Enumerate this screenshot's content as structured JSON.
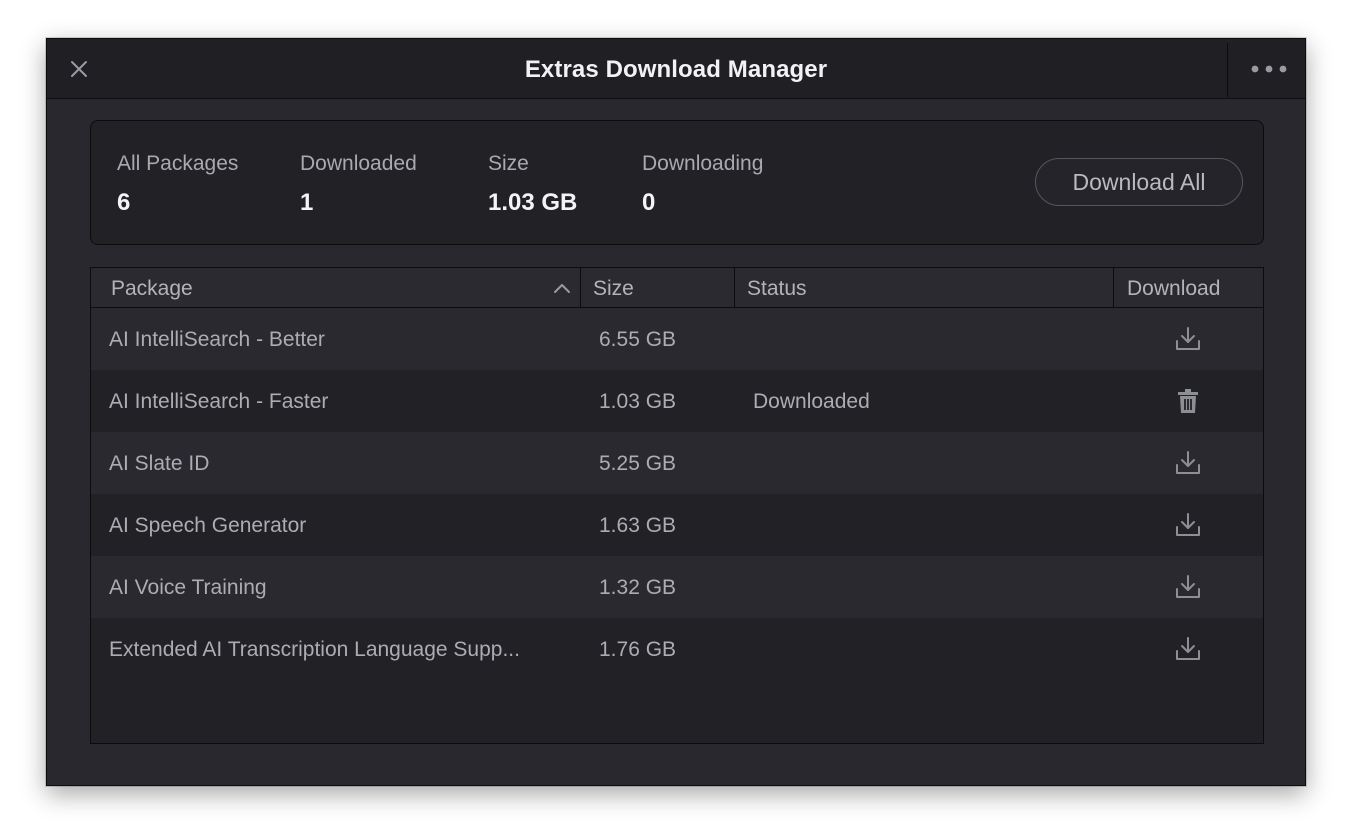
{
  "window": {
    "title": "Extras Download Manager",
    "close_icon": "close-icon",
    "more_icon": "more-horizontal-icon"
  },
  "summary": {
    "all_packages": {
      "label": "All Packages",
      "value": "6"
    },
    "downloaded": {
      "label": "Downloaded",
      "value": "1"
    },
    "size": {
      "label": "Size",
      "value": "1.03 GB"
    },
    "downloading": {
      "label": "Downloading",
      "value": "0"
    },
    "download_all_label": "Download All"
  },
  "table": {
    "headers": {
      "package": "Package",
      "size": "Size",
      "status": "Status",
      "download": "Download"
    },
    "sort": {
      "column": "package",
      "direction": "ascending"
    },
    "rows": [
      {
        "package": "AI IntelliSearch - Better",
        "size": "6.55 GB",
        "status": "",
        "action_icon": "download-icon"
      },
      {
        "package": "AI IntelliSearch - Faster",
        "size": "1.03 GB",
        "status": "Downloaded",
        "action_icon": "trash-icon"
      },
      {
        "package": "AI Slate ID",
        "size": "5.25 GB",
        "status": "",
        "action_icon": "download-icon"
      },
      {
        "package": "AI Speech Generator",
        "size": "1.63 GB",
        "status": "",
        "action_icon": "download-icon"
      },
      {
        "package": "AI Voice Training",
        "size": "1.32 GB",
        "status": "",
        "action_icon": "download-icon"
      },
      {
        "package": "Extended AI Transcription Language Supp...",
        "size": "1.76 GB",
        "status": "",
        "action_icon": "download-icon"
      }
    ]
  },
  "colors": {
    "window_bg": "#28282e",
    "titlebar_bg": "#1f1f24",
    "panel_bg": "#212126",
    "row_alt_bg": "#29292f",
    "text_primary": "#f2f2f4",
    "text_secondary": "#acacb3",
    "icon": "#8e8e95"
  }
}
